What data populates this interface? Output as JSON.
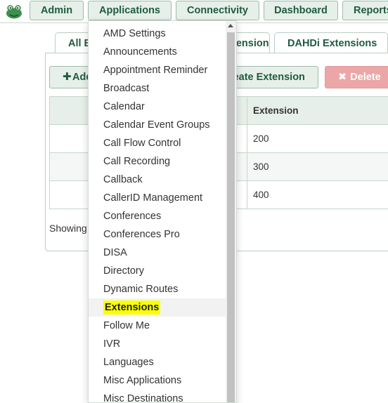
{
  "nav": {
    "admin": "Admin",
    "applications": "Applications",
    "connectivity": "Connectivity",
    "dashboard": "Dashboard",
    "reports": "Reports"
  },
  "tabs": {
    "all": "All Extensions",
    "user": "User Extensions",
    "dahdi": "DAHDi Extensions"
  },
  "actions": {
    "add": "Add Extension",
    "create": "Bulk Create Extension",
    "delete": "Delete"
  },
  "table": {
    "header_extension": "Extension",
    "rows": [
      {
        "extension": "200"
      },
      {
        "extension": "300"
      },
      {
        "extension": "400"
      }
    ]
  },
  "showing_text": "Showing",
  "menu": {
    "items": [
      "AMD Settings",
      "Announcements",
      "Appointment Reminder",
      "Broadcast",
      "Calendar",
      "Calendar Event Groups",
      "Call Flow Control",
      "Call Recording",
      "Callback",
      "CallerID Management",
      "Conferences",
      "Conferences Pro",
      "DISA",
      "Directory",
      "Dynamic Routes",
      "Extensions",
      "Follow Me",
      "IVR",
      "Languages",
      "Misc Applications",
      "Misc Destinations"
    ],
    "highlighted": "Extensions"
  },
  "colors": {
    "accent": "#1f5c3e",
    "button_bg": "#e6efe9",
    "delete_bg": "#eba7a7",
    "highlight": "#fbff00"
  }
}
